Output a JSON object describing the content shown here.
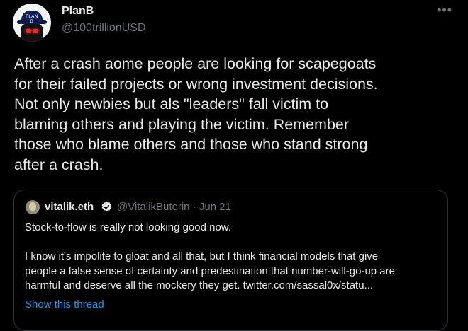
{
  "author": {
    "name": "PlanB",
    "handle": "@100trillionUSD",
    "avatar_cap_text": "PLAN B"
  },
  "menu_icon": "ellipsis-icon",
  "tweet_text": "After a crash aome people are looking for scapegoats\nfor their failed projects or wrong investment decisions.\nNot only newbies but als \"leaders\" fall victim to\nblaming others and playing the victim. Remember\nthose who blame others and those who stand strong\nafter a crash.",
  "quoted": {
    "name": "vitalik.eth",
    "verified_icon": "verified-badge-icon",
    "meta": "@VitalikButerin · Jun 21",
    "text": "Stock-to-flow is really not looking good now.\n\nI know it's impolite to gloat and all that, but I think financial models that give\npeople a false sense of certainty and predestination that number-will-go-up are\nharmful and deserve all the mockery they get.  twitter.com/sassal0x/statu...",
    "show_thread": "Show this thread"
  },
  "colors": {
    "background": "#000000",
    "text": "#e7e9ea",
    "secondary": "#71767b",
    "link": "#1d9bf0",
    "border": "#2f3336"
  }
}
